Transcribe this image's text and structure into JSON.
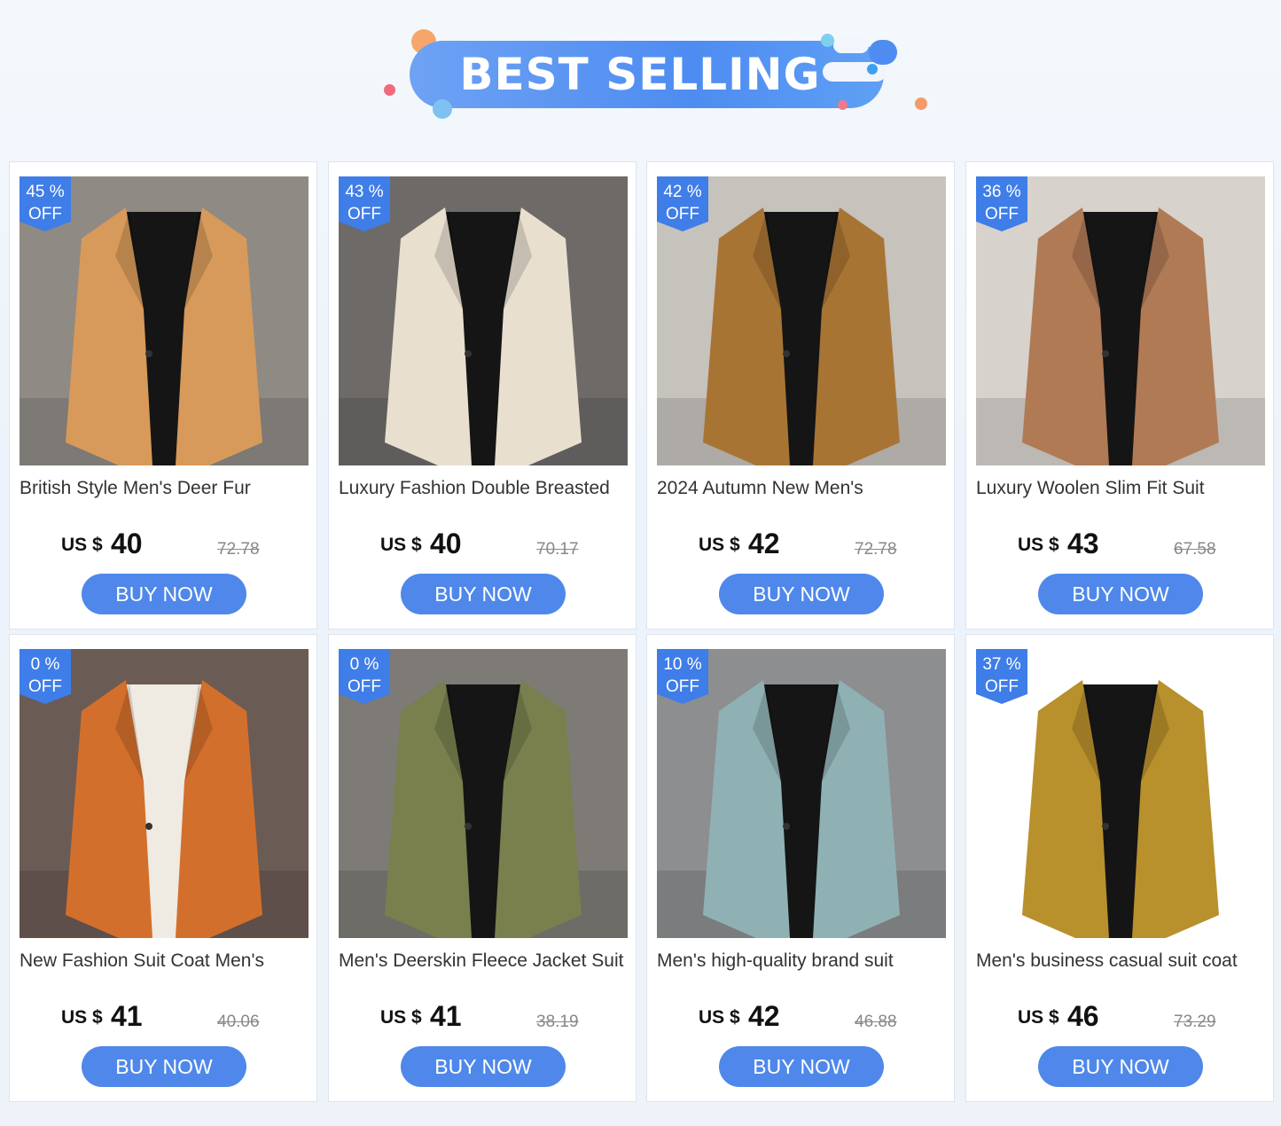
{
  "header": {
    "title": "BEST SELLING"
  },
  "colors": {
    "accent": "#4f88ea",
    "badge": "#3f7de8",
    "banner": "#5b96f2"
  },
  "products": [
    {
      "discount": "45  %",
      "off": "OFF",
      "title": "British Style Men's Deer Fur",
      "currency": "US $",
      "price": "40",
      "old_price": "72.78",
      "button": "BUY NOW",
      "jacket_color": "#d79a5a"
    },
    {
      "discount": "43  %",
      "off": "OFF",
      "title": "Luxury Fashion Double Breasted",
      "currency": "US $",
      "price": "40",
      "old_price": "70.17",
      "button": "BUY NOW",
      "jacket_color": "#e8dfcf"
    },
    {
      "discount": "42  %",
      "off": "OFF",
      "title": "2024 Autumn New Men's",
      "currency": "US $",
      "price": "42",
      "old_price": "72.78",
      "button": "BUY NOW",
      "jacket_color": "#a87434"
    },
    {
      "discount": "36  %",
      "off": "OFF",
      "title": "Luxury Woolen Slim Fit Suit",
      "currency": "US $",
      "price": "43",
      "old_price": "67.58",
      "button": "BUY NOW",
      "jacket_color": "#b07a55"
    },
    {
      "discount": "0  %",
      "off": "OFF",
      "title": "New Fashion Suit Coat Men's",
      "currency": "US $",
      "price": "41",
      "old_price": "40.06",
      "button": "BUY NOW",
      "jacket_color": "#d36f2c"
    },
    {
      "discount": "0  %",
      "off": "OFF",
      "title": "Men's Deerskin Fleece Jacket Suit",
      "currency": "US $",
      "price": "41",
      "old_price": "38.19",
      "button": "BUY NOW",
      "jacket_color": "#79804e"
    },
    {
      "discount": "10  %",
      "off": "OFF",
      "title": "Men's high-quality brand suit",
      "currency": "US $",
      "price": "42",
      "old_price": "46.88",
      "button": "BUY NOW",
      "jacket_color": "#8fb1b4"
    },
    {
      "discount": "37  %",
      "off": "OFF",
      "title": "Men's business casual suit coat",
      "currency": "US $",
      "price": "46",
      "old_price": "73.29",
      "button": "BUY NOW",
      "jacket_color": "#b8902c"
    }
  ]
}
